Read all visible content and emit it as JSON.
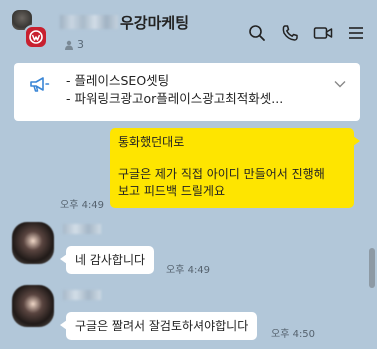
{
  "header": {
    "title": "우강마케팅",
    "member_count": "3",
    "icons": [
      "search-icon",
      "phone-icon",
      "video-icon",
      "menu-icon"
    ]
  },
  "notice": {
    "icon": "megaphone-icon",
    "lines": [
      "- 플레이스SEO셋팅",
      "- 파워링크광고or플레이스광고최적화셋..."
    ]
  },
  "messages": {
    "m1_line1": "통화했던대로",
    "m1_line2": "구글은 제가 직접 아이디 만들어서 진행해",
    "m1_line3": "보고 피드백 드릴게요",
    "m1_time": "오후 4:49",
    "m2_text": "네 감사합니다",
    "m2_time": "오후 4:49",
    "m3_text": "구글은 짤려서 잘검토하셔야합니다",
    "m3_time": "오후 4:50"
  },
  "colors": {
    "background": "#b2c7d9",
    "my_bubble": "#fee500",
    "brand_logo": "#c8202f"
  }
}
